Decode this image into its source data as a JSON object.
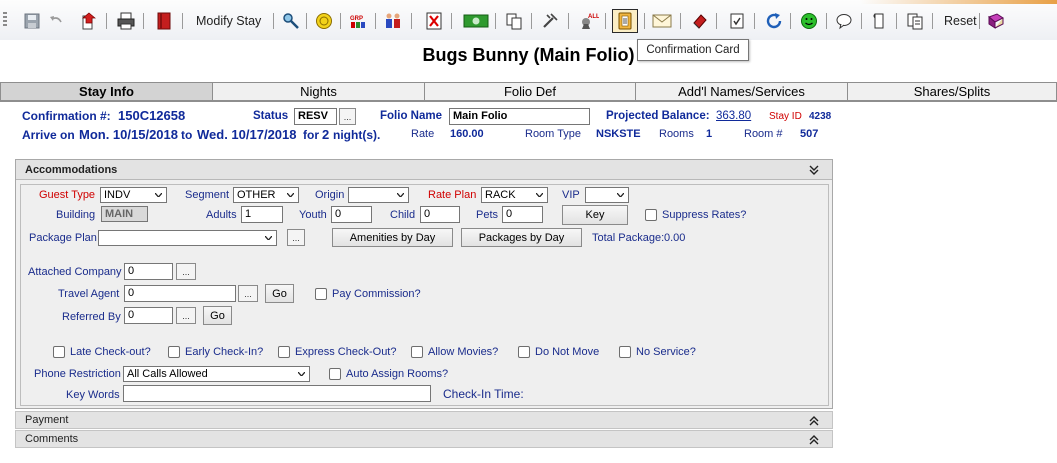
{
  "toolbar": {
    "modify_stay_label": "Modify Stay",
    "reset_label": "Reset",
    "active_tooltip": "Confirmation Card",
    "icons": [
      "save-icon",
      "undo-icon",
      "check-out-icon",
      "print-icon",
      "folio-icon",
      "search-key-icon",
      "coin-icon",
      "group-icon",
      "people-icon",
      "cancel-icon",
      "cash-icon",
      "copy-icon",
      "tools-icon",
      "alert-icon",
      "confirmation-card-icon",
      "mail-icon",
      "eraser-icon",
      "checklist-icon",
      "refresh-icon",
      "smiley-icon",
      "message-icon",
      "document-icon",
      "documents-icon",
      "book-icon"
    ]
  },
  "page_title": "Bugs Bunny (Main Folio)",
  "tabs": [
    "Stay Info",
    "Nights",
    "Folio Def",
    "Add'l Names/Services",
    "Shares/Splits"
  ],
  "header": {
    "confirmation_label": "Confirmation #:",
    "confirmation_value": "150C12658",
    "status_label": "Status",
    "status_value": "RESV",
    "folio_name_label": "Folio Name",
    "folio_name_value": "Main Folio",
    "projected_balance_label": "Projected Balance:",
    "projected_balance_value": "363.80",
    "stay_id_label": "Stay ID",
    "stay_id_value": "4238",
    "arrive_on_label": "Arrive on",
    "arrive_date": "Mon. 10/15/2018",
    "to_label": "to",
    "depart_date": "Wed. 10/17/2018",
    "for_label": "for",
    "nights_count": "2",
    "nights_label": "night(s).",
    "rate_label": "Rate",
    "rate_value": "160.00",
    "room_type_label": "Room Type",
    "room_type_value": "NSKSTE",
    "rooms_label": "Rooms",
    "rooms_value": "1",
    "room_num_label": "Room #",
    "room_num_value": "507"
  },
  "accommodations": {
    "title": "Accommodations",
    "guest_type_label": "Guest Type",
    "guest_type_value": "INDV",
    "segment_label": "Segment",
    "segment_value": "OTHER",
    "origin_label": "Origin",
    "origin_value": "",
    "rate_plan_label": "Rate Plan",
    "rate_plan_value": "RACK",
    "vip_label": "VIP",
    "vip_value": "",
    "building_label": "Building",
    "building_value": "MAIN",
    "adults_label": "Adults",
    "adults_value": "1",
    "youth_label": "Youth",
    "youth_value": "0",
    "child_label": "Child",
    "child_value": "0",
    "pets_label": "Pets",
    "pets_value": "0",
    "key_button": "Key",
    "suppress_rates_label": "Suppress Rates?",
    "package_plan_label": "Package Plan",
    "package_plan_value": "",
    "ellipsis": "...",
    "amenities_button": "Amenities by Day",
    "packages_button": "Packages by Day",
    "total_package_label": "Total Package:",
    "total_package_value": "0.00",
    "attached_company_label": "Attached Company",
    "attached_company_value": "0",
    "travel_agent_label": "Travel Agent",
    "travel_agent_value": "0",
    "go_label": "Go",
    "pay_commission_label": "Pay Commission?",
    "referred_by_label": "Referred By",
    "referred_by_value": "0",
    "late_checkout_label": "Late Check-out?",
    "early_checkin_label": "Early Check-In?",
    "express_checkout_label": "Express Check-Out?",
    "allow_movies_label": "Allow Movies?",
    "do_not_move_label": "Do Not Move",
    "no_service_label": "No Service?",
    "phone_restriction_label": "Phone Restriction",
    "phone_restriction_value": "All Calls Allowed",
    "auto_assign_label": "Auto Assign Rooms?",
    "key_words_label": "Key Words",
    "key_words_value": "",
    "checkin_time_label": "Check-In Time:"
  },
  "sections": {
    "payment": "Payment",
    "comments": "Comments"
  },
  "colors": {
    "label_blue": "#102a9a",
    "required_red": "#d00000",
    "tab_active": "#d3d3d3",
    "panel_bg": "#efefef",
    "accent_orange": "#e8a046"
  }
}
